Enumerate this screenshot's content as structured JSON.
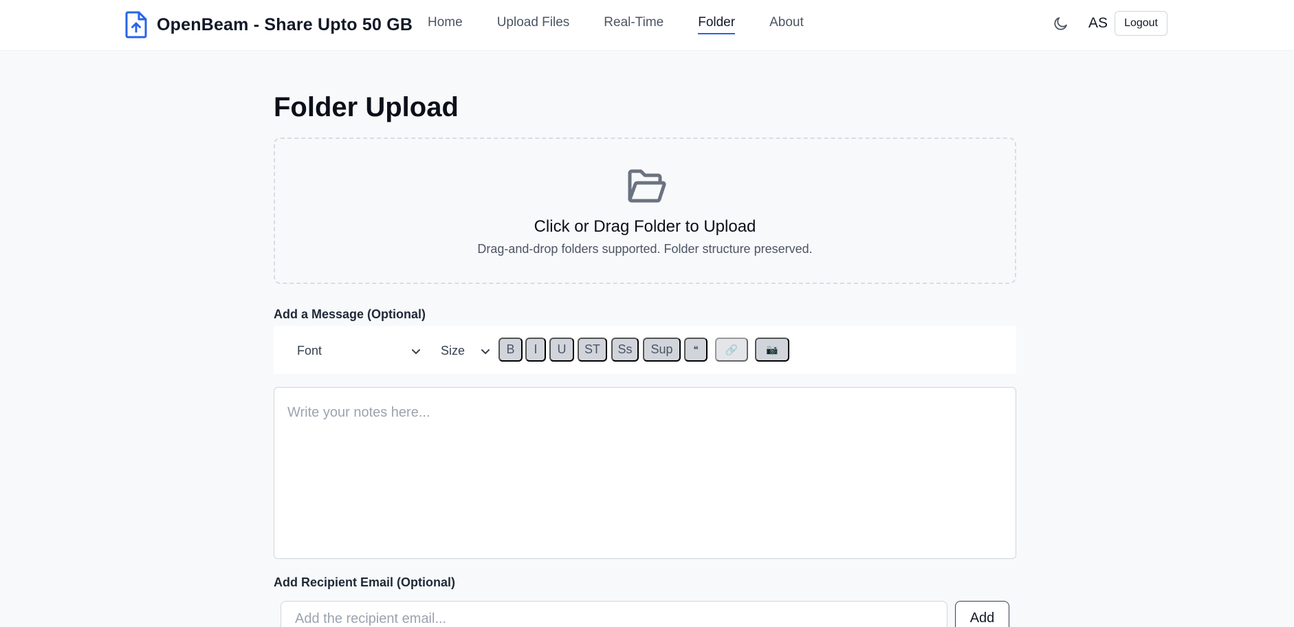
{
  "header": {
    "brand_title": "OpenBeam - Share Upto 50 GB",
    "nav": [
      {
        "label": "Home",
        "active": false
      },
      {
        "label": "Upload Files",
        "active": false
      },
      {
        "label": "Real-Time",
        "active": false
      },
      {
        "label": "Folder",
        "active": true
      },
      {
        "label": "About",
        "active": false
      }
    ],
    "theme_toggle_icon": "moon-icon",
    "user_initials": "AS",
    "logout_label": "Logout"
  },
  "main": {
    "title": "Folder Upload",
    "dropzone": {
      "icon": "folder-open-icon",
      "title": "Click or Drag Folder to Upload",
      "subtitle": "Drag-and-drop folders supported. Folder structure preserved."
    },
    "message": {
      "label": "Add a Message (Optional)",
      "font_select": "Font",
      "size_select": "Size",
      "buttons": [
        "B",
        "I",
        "U",
        "ST",
        "Ss",
        "Sup",
        "❝",
        "🔗",
        "📷"
      ],
      "placeholder": "Write your notes here..."
    },
    "recipient": {
      "label": "Add Recipient Email (Optional)",
      "placeholder": "Add the recipient email...",
      "add_label": "Add"
    }
  },
  "colors": {
    "accent": "#2563eb",
    "background": "#f8f9fb",
    "toolbar_button": "#d1d5db"
  }
}
